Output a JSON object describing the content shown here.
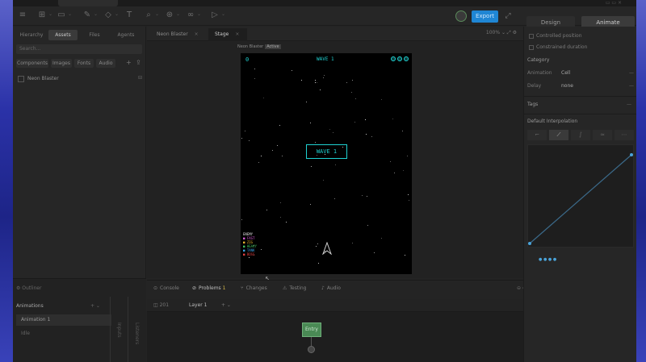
{
  "window": {
    "right_text": "▭ ▭ ×"
  },
  "toolbar": {
    "export_label": "Export",
    "expand_icon": "expand-icon"
  },
  "right_tabs": {
    "design": "Design",
    "animate": "Animate"
  },
  "left_panel": {
    "tabs": [
      "Hierarchy",
      "Assets",
      "Files",
      "Agents"
    ],
    "search_placeholder": "Search...",
    "filters": [
      "Components",
      "Images",
      "Fonts",
      "Audio"
    ],
    "asset_item": "Neon Blaster"
  },
  "state_panel": {
    "header": "⚙ Outliner",
    "title": "Animations",
    "list_item": "Animation 1",
    "second_item": "Idle",
    "vertical_labels": [
      "Inputs",
      "Listeners"
    ]
  },
  "center": {
    "tabs": [
      {
        "label": "Neon Blaster",
        "active": false
      },
      {
        "label": "Stage",
        "active": true
      }
    ],
    "tools": "100% ⌄  ⤢  ⚙",
    "stage_title": "Neon Blaster",
    "stage_badge": "Active"
  },
  "game": {
    "score": "0",
    "wave_label": "WAVE 1",
    "banner": "WAVE 1",
    "lives": 3,
    "accent_color": "#1fd1d1",
    "legend": [
      {
        "text": "ENEMY",
        "color": "#e0e0e0"
      },
      {
        "text": "■ FAST",
        "color": "#d65ad6"
      },
      {
        "text": "■ ZIG",
        "color": "#e0b030"
      },
      {
        "text": "■ HEAVY",
        "color": "#40c060"
      },
      {
        "text": "■ TANK",
        "color": "#3aa0e0"
      },
      {
        "text": "■ BOSS",
        "color": "#e04040"
      }
    ]
  },
  "bottom_tabs": [
    {
      "icon": "⊙",
      "label": "Console",
      "active": false
    },
    {
      "icon": "⊘",
      "label": "Problems",
      "badge": "1",
      "active": true
    },
    {
      "icon": "⑂",
      "label": "Changes",
      "active": false
    },
    {
      "icon": "⚠",
      "label": "Testing",
      "active": false
    },
    {
      "icon": "♪",
      "label": "Audio",
      "active": false
    }
  ],
  "timeline": {
    "tabs": [
      "◫ 201",
      "Layer 1"
    ],
    "entry_node": "Entry"
  },
  "right_panel": {
    "checks": [
      "Controlled position",
      "Constrained duration"
    ],
    "category_label": "Category",
    "rows": [
      {
        "label": "Animation",
        "value": "Cell"
      },
      {
        "label": "Delay",
        "value": "none"
      }
    ],
    "tags_label": "Tags",
    "interp_label": "Default Interpolation",
    "dots": "● ● ● ●"
  }
}
